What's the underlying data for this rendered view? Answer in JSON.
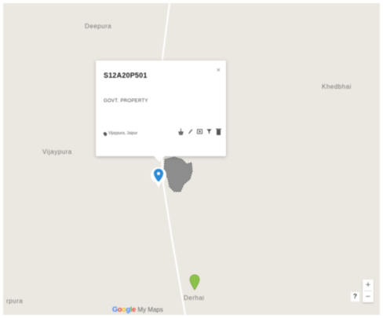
{
  "map": {
    "places": {
      "deepura": "Deepura",
      "khedbhai": "Khedbhai",
      "vijaypura": "Vijaypura",
      "derhai": "Derhai",
      "erpura": "rpura"
    },
    "colors": {
      "land": "#ebe7e1",
      "road": "#ffffff",
      "parcel_fill": "#8d8d8d",
      "selected_pin": "#2a8ad8",
      "green_pin": "#8bc34a"
    }
  },
  "popup": {
    "title": "S12A20P501",
    "subtitle": "GOVT. PROPERTY",
    "location": "Vijaypura, Jaipur",
    "close_label": "×"
  },
  "controls": {
    "zoom_in": "+",
    "zoom_out": "−",
    "help": "?"
  },
  "branding": {
    "google": [
      "G",
      "o",
      "o",
      "g",
      "l",
      "e"
    ],
    "google_colors": [
      "#4285F4",
      "#EA4335",
      "#FBBC05",
      "#4285F4",
      "#34A853",
      "#EA4335"
    ],
    "product": "My Maps"
  },
  "icons": [
    "close-icon",
    "location-pin-icon",
    "style-icon",
    "edit-icon",
    "photo-icon",
    "filter-icon",
    "delete-icon",
    "map-marker-icon"
  ]
}
